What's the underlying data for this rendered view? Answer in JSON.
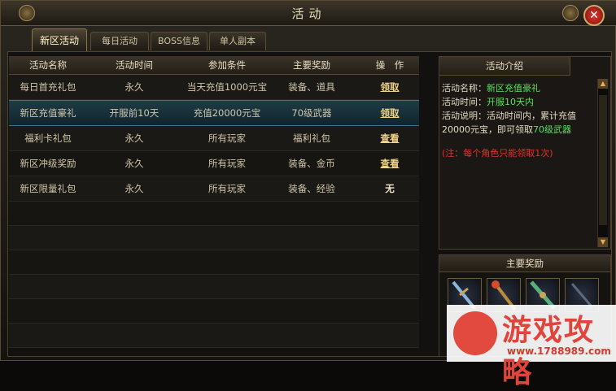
{
  "window": {
    "title": "活动"
  },
  "tabs": [
    {
      "label": "新区活动",
      "active": true
    },
    {
      "label": "每日活动",
      "active": false
    },
    {
      "label": "BOSS信息",
      "active": false
    },
    {
      "label": "单人副本",
      "active": false
    }
  ],
  "table": {
    "headers": [
      "活动名称",
      "活动时间",
      "参加条件",
      "主要奖励",
      "操　作"
    ],
    "rows": [
      {
        "name": "每日首充礼包",
        "time": "永久",
        "condition": "当天充值1000元宝",
        "reward": "装备、道具",
        "action": "领取"
      },
      {
        "name": "新区充值豪礼",
        "time": "开服前10天",
        "condition": "充值20000元宝",
        "reward": "70级武器",
        "action": "领取"
      },
      {
        "name": "福利卡礼包",
        "time": "永久",
        "condition": "所有玩家",
        "reward": "福利礼包",
        "action": "查看"
      },
      {
        "name": "新区冲级奖励",
        "time": "永久",
        "condition": "所有玩家",
        "reward": "装备、金币",
        "action": "查看"
      },
      {
        "name": "新区限量礼包",
        "time": "永久",
        "condition": "所有玩家",
        "reward": "装备、经验",
        "action": "无"
      }
    ]
  },
  "intro": {
    "title": "活动介绍",
    "name_label": "活动名称：",
    "name_value": "新区充值豪礼",
    "time_label": "活动时间：",
    "time_value": "开服10天内",
    "desc_label": "活动说明：",
    "desc_text": "活动时间内，累计充值20000元宝，即可领取",
    "desc_value": "70级武器",
    "note": "(注：每个角色只能领取1次)"
  },
  "rewards": {
    "title": "主要奖励"
  },
  "watermark": {
    "title": "游戏攻略",
    "url": "www.1788989.com"
  },
  "colors": {
    "highlight": "#5fe05f",
    "note": "#e0332b",
    "selected_row": "#1f3b45"
  }
}
